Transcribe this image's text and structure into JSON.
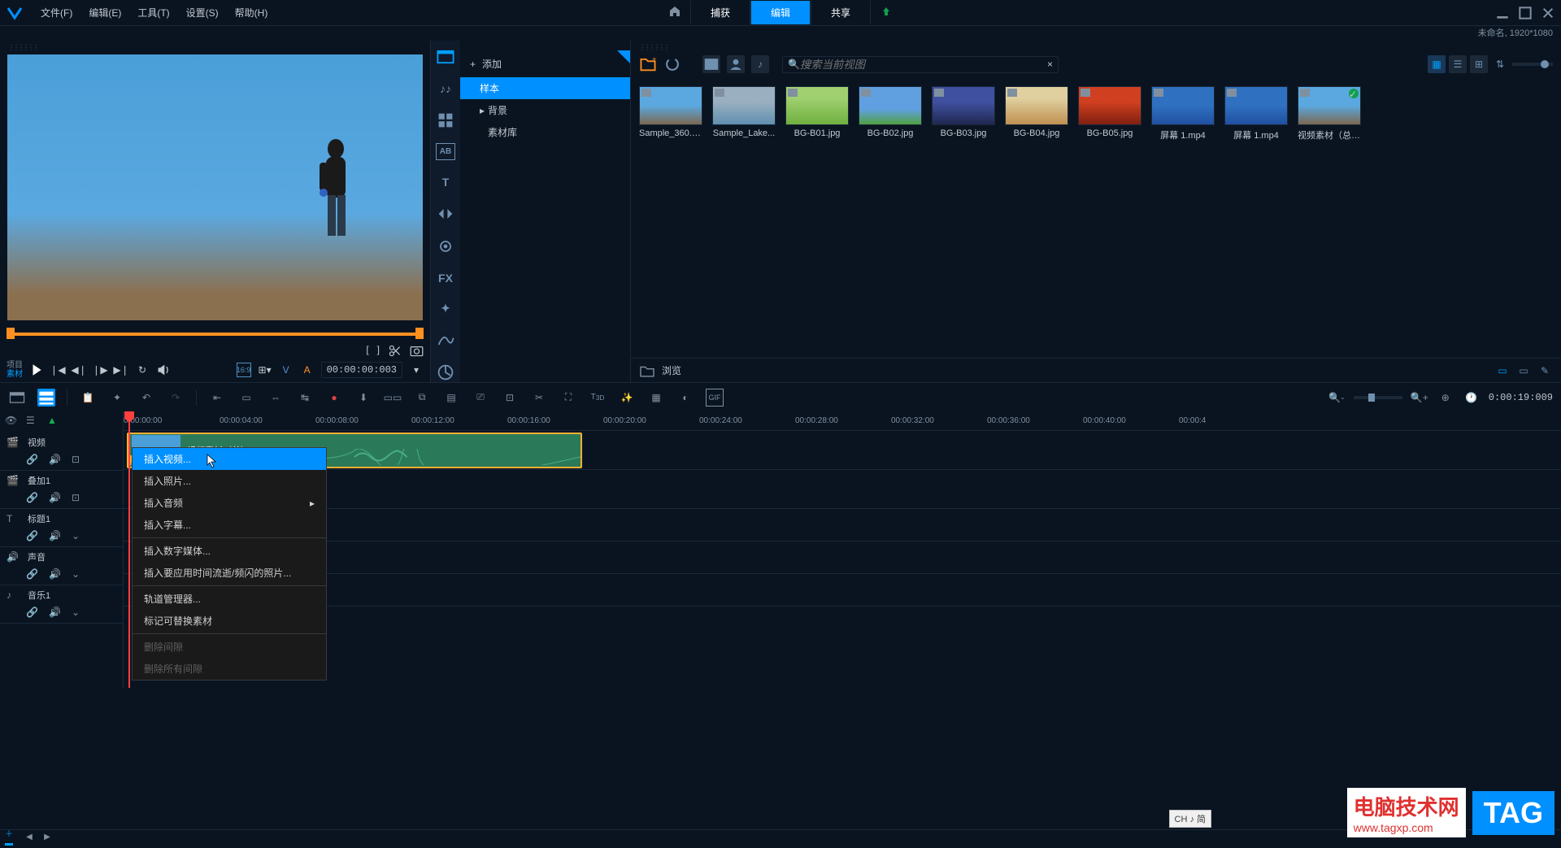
{
  "menubar": {
    "items": [
      "文件(F)",
      "编辑(E)",
      "工具(T)",
      "设置(S)",
      "帮助(H)"
    ],
    "tabs": {
      "capture": "捕获",
      "edit": "编辑",
      "share": "共享"
    },
    "status": "未命名, 1920*1080"
  },
  "preview": {
    "label_project": "项目",
    "label_material": "素材",
    "aspect": "16:9",
    "va_v": "V",
    "va_a": "A",
    "timecode": "00:00:00:003"
  },
  "sidebar_tools": [
    "media",
    "audio",
    "template",
    "subtitle",
    "text",
    "transition",
    "fx",
    "color",
    "motion",
    "curve",
    "circle"
  ],
  "library": {
    "add": "添加",
    "items": [
      "样本",
      "背景",
      "素材库"
    ]
  },
  "media": {
    "search_placeholder": "搜索当前视图",
    "browse": "浏览",
    "items": [
      {
        "name": "Sample_360.m...",
        "type": "video"
      },
      {
        "name": "Sample_Lake...",
        "type": "video"
      },
      {
        "name": "BG-B01.jpg",
        "type": "image"
      },
      {
        "name": "BG-B02.jpg",
        "type": "image"
      },
      {
        "name": "BG-B03.jpg",
        "type": "image"
      },
      {
        "name": "BG-B04.jpg",
        "type": "image"
      },
      {
        "name": "BG-B05.jpg",
        "type": "image"
      },
      {
        "name": "屏幕 1.mp4",
        "type": "video"
      },
      {
        "name": "屏幕 1.mp4",
        "type": "video"
      },
      {
        "name": "视频素材（总）...",
        "type": "video",
        "checked": true
      }
    ]
  },
  "timeline": {
    "timecode": "0:00:19:009",
    "ruler": [
      "0:00:00:00",
      "00:00:04:00",
      "00:00:08:00",
      "00:00:12:00",
      "00:00:16:00",
      "00:00:20:00",
      "00:00:24:00",
      "00:00:28:00",
      "00:00:32:00",
      "00:00:36:00",
      "00:00:40:00",
      "00:00:4"
    ],
    "tracks": [
      {
        "name": "视频",
        "type": "video"
      },
      {
        "name": "叠加1",
        "type": "video"
      },
      {
        "name": "标题1",
        "type": "title"
      },
      {
        "name": "声音",
        "type": "audio"
      },
      {
        "name": "音乐1",
        "type": "music"
      }
    ],
    "clip_label": "视频素材（总）.mp4"
  },
  "context_menu": {
    "items": [
      {
        "label": "插入视频...",
        "highlight": true
      },
      {
        "label": "插入照片..."
      },
      {
        "label": "插入音频",
        "submenu": true
      },
      {
        "label": "插入字幕..."
      },
      {
        "divider": true
      },
      {
        "label": "插入数字媒体..."
      },
      {
        "label": "插入要应用时间流逝/频闪的照片..."
      },
      {
        "divider": true
      },
      {
        "label": "轨道管理器..."
      },
      {
        "label": "标记可替换素材"
      },
      {
        "divider": true
      },
      {
        "label": "删除间隙",
        "disabled": true
      },
      {
        "label": "删除所有间隙",
        "disabled": true
      }
    ]
  },
  "ime": "CH ♪ 简",
  "watermark": {
    "title": "电脑技术网",
    "url": "www.tagxp.com",
    "tag": "TAG"
  },
  "thumb_colors": {
    "0": "linear-gradient(180deg,#5ba8e0 50%,#7a6850 100%)",
    "1": "linear-gradient(180deg,#9ab0c0 40%,#6090b0 100%)",
    "2": "linear-gradient(180deg,#a0d070 30%,#70b040 100%)",
    "3": "linear-gradient(180deg,#60a0e0 60%,#50a040 100%)",
    "4": "linear-gradient(180deg,#4050a0 40%,#202850 100%)",
    "5": "linear-gradient(180deg,#e0d0a0 30%,#c09050 100%)",
    "6": "linear-gradient(180deg,#d04020 40%,#802010 100%)",
    "7": "linear-gradient(180deg,#3070c0 50%,#2050a0 100%)",
    "8": "linear-gradient(180deg,#3070c0 50%,#2050a0 100%)",
    "9": "linear-gradient(180deg,#5ba8e0 50%,#7a6850 100%)"
  }
}
